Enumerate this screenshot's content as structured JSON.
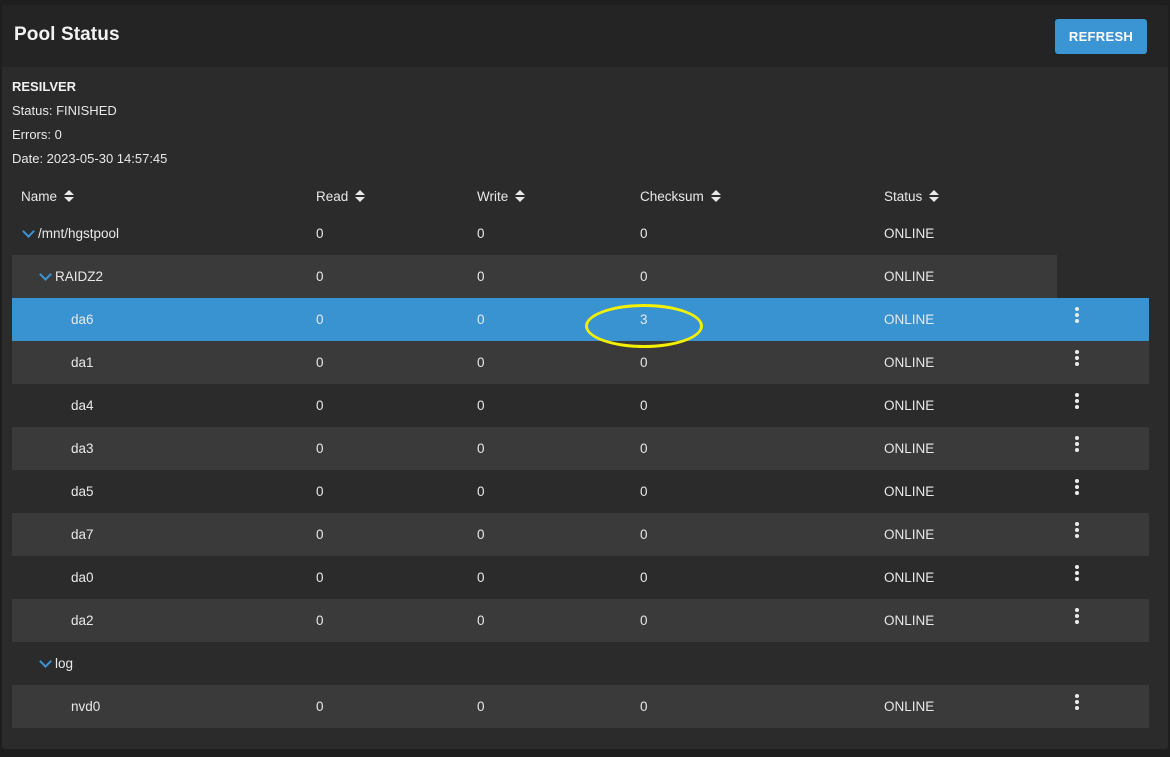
{
  "header": {
    "title": "Pool Status",
    "refresh_label": "REFRESH"
  },
  "scan": {
    "type": "RESILVER",
    "status": "Status: FINISHED",
    "errors": "Errors: 0",
    "date": "Date: 2023-05-30 14:57:45"
  },
  "columns": {
    "name": "Name",
    "read": "Read",
    "write": "Write",
    "checksum": "Checksum",
    "status": "Status"
  },
  "rows": [
    {
      "name": "/mnt/hgstpool",
      "read": "0",
      "write": "0",
      "checksum": "0",
      "status": "ONLINE"
    },
    {
      "name": "RAIDZ2",
      "read": "0",
      "write": "0",
      "checksum": "0",
      "status": "ONLINE"
    },
    {
      "name": "da6",
      "read": "0",
      "write": "0",
      "checksum": "3",
      "status": "ONLINE"
    },
    {
      "name": "da1",
      "read": "0",
      "write": "0",
      "checksum": "0",
      "status": "ONLINE"
    },
    {
      "name": "da4",
      "read": "0",
      "write": "0",
      "checksum": "0",
      "status": "ONLINE"
    },
    {
      "name": "da3",
      "read": "0",
      "write": "0",
      "checksum": "0",
      "status": "ONLINE"
    },
    {
      "name": "da5",
      "read": "0",
      "write": "0",
      "checksum": "0",
      "status": "ONLINE"
    },
    {
      "name": "da7",
      "read": "0",
      "write": "0",
      "checksum": "0",
      "status": "ONLINE"
    },
    {
      "name": "da0",
      "read": "0",
      "write": "0",
      "checksum": "0",
      "status": "ONLINE"
    },
    {
      "name": "da2",
      "read": "0",
      "write": "0",
      "checksum": "0",
      "status": "ONLINE"
    },
    {
      "name": "log",
      "read": "",
      "write": "",
      "checksum": "",
      "status": ""
    },
    {
      "name": "nvd0",
      "read": "0",
      "write": "0",
      "checksum": "0",
      "status": "ONLINE"
    }
  ],
  "colors": {
    "accent": "#3b95d3",
    "selected_row": "#3a93d1",
    "annotation": "#f4f000"
  },
  "icons": {
    "sort": "sort-updown-icon",
    "expand": "chevron-down-icon",
    "menu": "more-vert-icon"
  }
}
